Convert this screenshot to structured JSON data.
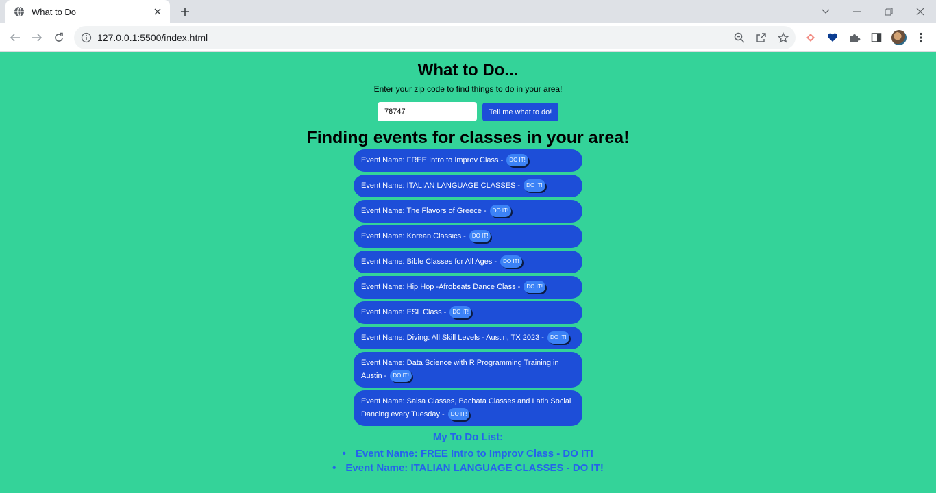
{
  "browser": {
    "tab_title": "What to Do",
    "url": "127.0.0.1:5500/index.html"
  },
  "page": {
    "title": "What to Do...",
    "subtitle": "Enter your zip code to find things to do in your area!",
    "zip_value": "78747",
    "search_button": "Tell me what to do!",
    "results_heading": "Finding events for classes in your area!",
    "do_it_label": "DO IT!",
    "events": [
      "Event Name: FREE Intro to Improv Class -",
      "Event Name: ITALIAN LANGUAGE CLASSES -",
      "Event Name: The Flavors of Greece -",
      "Event Name: Korean Classics -",
      "Event Name: Bible Classes for All Ages -",
      "Event Name: Hip Hop -Afrobeats Dance Class -",
      "Event Name: ESL Class -",
      "Event Name: Diving: All Skill Levels - Austin, TX 2023 -",
      "Event Name: Data Science with R Programming Training in Austin -",
      "Event Name: Salsa Classes, Bachata Classes and Latin Social Dancing every Tuesday -"
    ],
    "todo_heading": "My To Do List:",
    "todo_items": [
      "Event Name: FREE Intro to Improv Class - DO IT!",
      "Event Name: ITALIAN LANGUAGE CLASSES - DO IT!"
    ]
  }
}
